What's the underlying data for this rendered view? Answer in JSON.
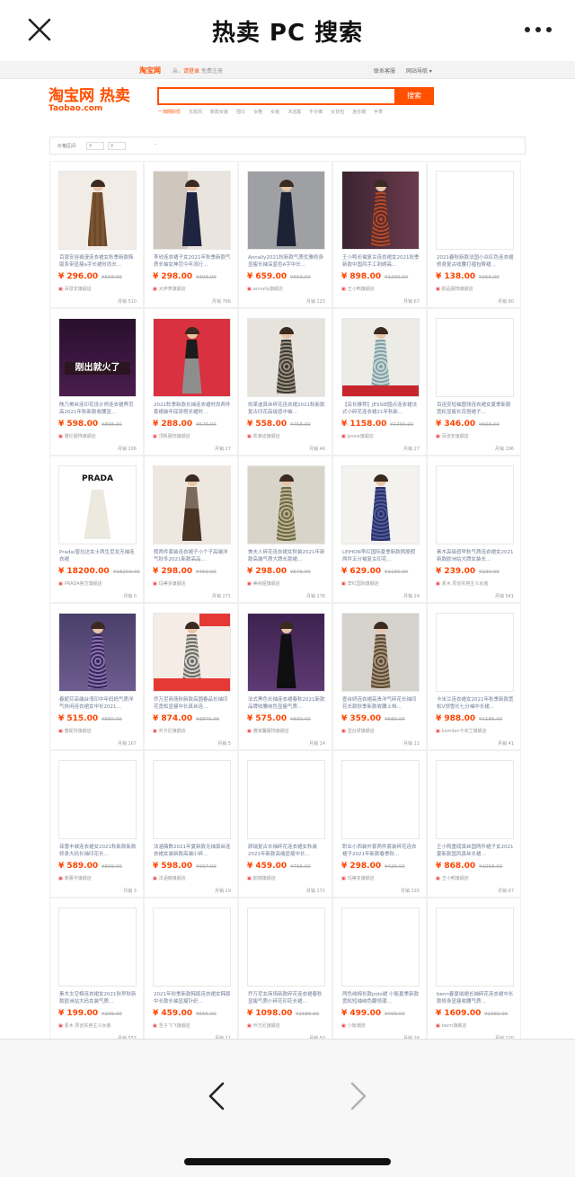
{
  "app": {
    "title": "热卖 PC 搜索"
  },
  "site": {
    "logo_small": "淘宝网",
    "greet_prefix": "亲，",
    "login": "请登录",
    "register": "免费注册",
    "service": "联系客服",
    "site_nav": "网站导航",
    "brand_cn": "淘宝网 热卖",
    "brand_en": "Taobao.com",
    "search_button": "搜索",
    "search_value": "",
    "hot_words": [
      "一淘网好优",
      "长款风",
      "新款女装",
      "围巾",
      "女鞋",
      "女装",
      "沐浴露",
      "牛仔裤",
      "女背包",
      "连衣裙",
      "手表"
    ]
  },
  "filter": {
    "label": "价格区间",
    "min": "¥",
    "max": "¥",
    "dash": "-"
  },
  "colors": {
    "accent": "#ff5000",
    "price": "#ff4400",
    "link": "#6f7b96"
  },
  "products": [
    {
      "desc": "百恩安谷裥漫连衣裙女秋季新款韩版系带显瘦a字长裙时尚长…",
      "price": "¥ 296.00",
      "orig": "¥558.00",
      "shop": "百恩安旗舰店",
      "sales": "月销 510",
      "art": "brown"
    },
    {
      "desc": "李欣连衣裙子女2021年秋季新款气质长袖女神范今年流行…",
      "price": "¥ 298.00",
      "orig": "¥398.00",
      "shop": "大伊笑旗舰店",
      "sales": "月销 766",
      "art": "navy-mirror"
    },
    {
      "desc": "Annally2021秋新款气质优雅修身显瘦长袖深蓝色A字中长…",
      "price": "¥ 659.00",
      "orig": "¥659.00",
      "shop": "annally旗舰店",
      "sales": "月销 123",
      "art": "navy"
    },
    {
      "desc": "王小鸭长袖复古连衣裙女2021秋季新款中国风手工刺绣高…",
      "price": "¥ 898.00",
      "orig": "¥1299.00",
      "shop": "王小鸭旗舰店",
      "sales": "月销 67",
      "art": "floral-red"
    },
    {
      "desc": "2021春秋新款法国小众红色连衣裙修身复古收腰打褶包臀裙…",
      "price": "¥ 138.00",
      "orig": "¥256.00",
      "shop": "颜品服饰旗舰店",
      "sales": "月销 80",
      "art": "blank"
    },
    {
      "desc": "陕乃美丝连印花设计师连衣裙界范高2021年秋新款收腰显…",
      "price": "¥ 598.00",
      "orig": "¥898.00",
      "shop": "雅伦服饰旗舰店",
      "sales": "月销 206",
      "art": "promo-hot"
    },
    {
      "desc": "2021秋季新款长袖连衣裙时尚两件套裙装年底穿搭长裙时…",
      "price": "¥ 288.00",
      "orig": "¥576.00",
      "shop": "顶帆服饰旗舰店",
      "sales": "月销 27",
      "art": "twopiece"
    },
    {
      "desc": "凯莱迪真丝碎花连衣裙2021秋新款复古印花高级感中袖…",
      "price": "¥ 558.00",
      "orig": "¥758.00",
      "shop": "凯莱迪旗舰店",
      "sales": "月销 46",
      "art": "floral-grey"
    },
    {
      "desc": "【店长推荐】JESSIE圆点连衣裙法式小碎花连衣裙21年秋新…",
      "price": "¥ 1158.00",
      "orig": "¥1799.00",
      "shop": "jessie旗舰店",
      "sales": "月销 27",
      "art": "jessie"
    },
    {
      "desc": "百连安短袖圆领连衣裙女夏季新款宽松显瘦长百搭裙子…",
      "price": "¥ 346.00",
      "orig": "¥698.00",
      "shop": "百连安旗舰店",
      "sales": "月销 196",
      "art": "blank"
    },
    {
      "desc": "Prada/普拉达女士两生尼龙无袖连衣裙",
      "price": "¥ 18200.00",
      "orig": "¥18200.00",
      "shop": "PRADA官方旗舰店",
      "sales": "月销 0",
      "art": "prada"
    },
    {
      "desc": "假两件套装连衣裙子小个子高端洋气秋冬2021新款高品…",
      "price": "¥ 298.00",
      "orig": "¥459.00",
      "shop": "玛蒂多旗舰店",
      "sales": "月销 271",
      "art": "brown-twopiece"
    },
    {
      "desc": "美夫人碎花连衣裙女秋装2021年新款高端气质大牌长款裙…",
      "price": "¥ 298.00",
      "orig": "¥576.00",
      "shop": "美纳娅旗舰店",
      "sales": "月销 176",
      "art": "floral-olive"
    },
    {
      "desc": "LEIHON李红国际夏季新款两股假两件五分袖复古印花…",
      "price": "¥ 629.00",
      "orig": "¥1180.00",
      "shop": "李红国际旗舰店",
      "sales": "月销 24",
      "art": "leihon"
    },
    {
      "desc": "素木高级感早秋气质连衣裙女2021新款欧洲站大牌女装长…",
      "price": "¥ 239.00",
      "orig": "¥239.00",
      "shop": "素木 原创实用主义女装",
      "sales": "月销 541",
      "art": "blank"
    },
    {
      "desc": "春妮芬高端台湾印中年妈妈气质洋气休闲连衣裙女中长2021…",
      "price": "¥ 515.00",
      "orig": "¥680.00",
      "shop": "春妮芬旗舰店",
      "sales": "月销 167",
      "art": "paisley"
    },
    {
      "desc": "乔万尼商场秋新款高圆春品长袖印花宽松显瘦中长真丝连…",
      "price": "¥ 874.00",
      "orig": "¥3876.00",
      "shop": "乔万尼旗舰店",
      "sales": "月销 5",
      "art": "promo-sale"
    },
    {
      "desc": "法式黑色长袖连衣裙春秋2021新款品牌收腰纯色显瘦气质…",
      "price": "¥ 575.00",
      "orig": "¥839.00",
      "shop": "雅淑馨服饰旗舰店",
      "sales": "月销 14",
      "art": "black-purple"
    },
    {
      "desc": "壹台妍连衣裙高贵洋气碎花长袖印花长款秋季新款收腰上档…",
      "price": "¥ 359.00",
      "orig": "¥589.00",
      "shop": "壹台妍旗舰店",
      "sales": "月销 11",
      "art": "leopard"
    },
    {
      "desc": "卡米兰连衣裙女2021年秋季新款宽松V领雪长七分袖中长裙…",
      "price": "¥ 988.00",
      "orig": "¥1186.00",
      "shop": "kamilan卡米兰旗舰店",
      "sales": "月销 41",
      "art": "blank"
    },
    {
      "desc": "菲蕾丰城连衣裙女2021秋新款新款修身大码长袖印花长…",
      "price": "¥ 589.00",
      "orig": "¥699.00",
      "shop": "菲蕾丰旗舰店",
      "sales": "月销 3",
      "art": "blank"
    },
    {
      "desc": "法涵薇数2021年夏新款无袖真丝连衣裙女装新款高端小碎…",
      "price": "¥ 598.00",
      "orig": "¥997.00",
      "shop": "法涵薇旗舰店",
      "sales": "月销 19",
      "art": "blank"
    },
    {
      "desc": "颜瑞复古长袖碎花连衣裙女秋装2021年新款高端显瘦中长…",
      "price": "¥ 459.00",
      "orig": "¥765.00",
      "shop": "颜瑞旗舰店",
      "sales": "月销 171",
      "art": "blank"
    },
    {
      "desc": "职业小西装外套两件套装碎花连衣裙子2021年新款春季秋…",
      "price": "¥ 298.00",
      "orig": "¥426.00",
      "shop": "玛蒂多旗舰店",
      "sales": "月销 220",
      "art": "blank"
    },
    {
      "desc": "王小鸭重磅真丝国两件裙子女2021夏新款国风真丝长裙…",
      "price": "¥ 868.00",
      "orig": "¥1068.00",
      "shop": "王小鸭旗舰店",
      "sales": "月销 67",
      "art": "blank"
    },
    {
      "desc": "素木太空棉连衣裙女2021秋早秋新款欧洲站大码女装气质…",
      "price": "¥ 199.00",
      "orig": "¥199.00",
      "shop": "素木 原创实用主义女装",
      "sales": "月销 557",
      "art": "blank"
    },
    {
      "desc": "2021年秋季新款韩版连衣裙女韩版中长款长袖显瘦针织…",
      "price": "¥ 459.00",
      "orig": "¥656.00",
      "shop": "圣子飞飞旗舰店",
      "sales": "月销 11",
      "art": "blank"
    },
    {
      "desc": "乔万尼女商场新款碎花连衣裙春秋显瘦气质小碎花印花长裙…",
      "price": "¥ 1098.00",
      "orig": "¥1586.00",
      "shop": "乔万尼旗舰店",
      "sales": "月销 50",
      "art": "blank"
    },
    {
      "desc": "两色纯棉长款polo裙 小衡夏季新款宽松短袖纯色翻领潮…",
      "price": "¥ 499.00",
      "orig": "¥499.00",
      "shop": "小衡潮流",
      "sales": "月销 26",
      "art": "blank"
    },
    {
      "desc": "benn春夏绒裙长袖碎花连衣裙中长款修身显瘦收腰气质…",
      "price": "¥ 1609.00",
      "orig": "¥1680.00",
      "shop": "benn旗舰店",
      "sales": "月销 120",
      "art": "blank"
    }
  ]
}
